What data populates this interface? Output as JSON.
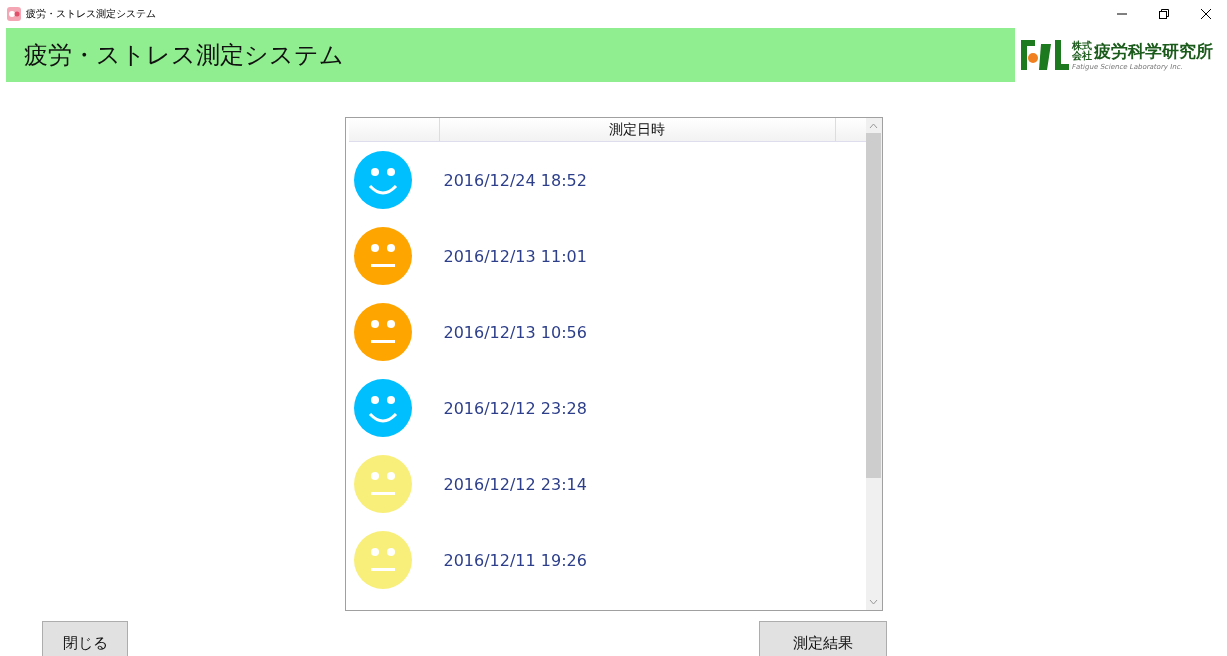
{
  "window": {
    "title": "疲労・ストレス測定システム"
  },
  "header": {
    "title": "疲労・ストレス測定システム",
    "company_prefix_top": "株式",
    "company_prefix_bottom": "会社",
    "company_name": "疲労科学研究所",
    "company_english": "Fatigue Science Laboratory Inc."
  },
  "list": {
    "columns": [
      "測定日時"
    ],
    "rows": [
      {
        "kind": "smile",
        "color": "#00bfff",
        "datetime": "2016/12/24 18:52"
      },
      {
        "kind": "neutral",
        "color": "#ffa500",
        "datetime": "2016/12/13 11:01"
      },
      {
        "kind": "neutral",
        "color": "#ffa500",
        "datetime": "2016/12/13 10:56"
      },
      {
        "kind": "smile",
        "color": "#00bfff",
        "datetime": "2016/12/12 23:28"
      },
      {
        "kind": "neutral",
        "color": "#f8ef7a",
        "datetime": "2016/12/12 23:14"
      },
      {
        "kind": "neutral",
        "color": "#f8ef7a",
        "datetime": "2016/12/11 19:26"
      }
    ]
  },
  "buttons": {
    "close": "閉じる",
    "results": "測定結果"
  }
}
